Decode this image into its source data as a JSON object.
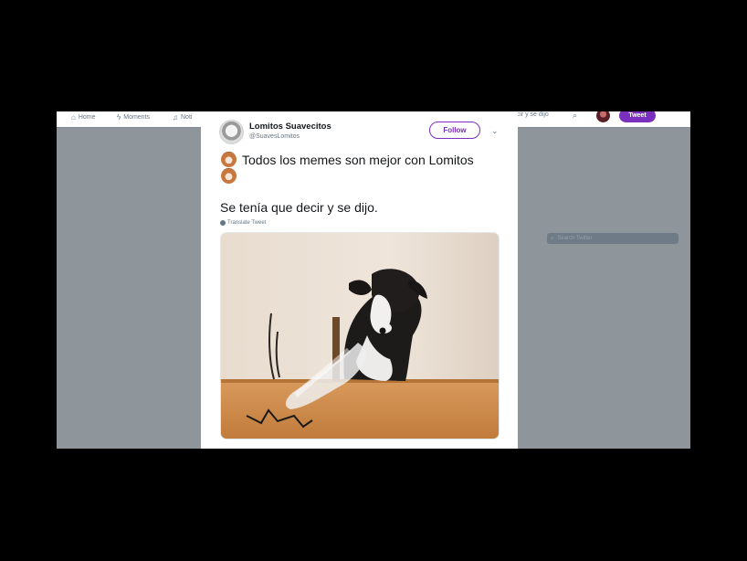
{
  "topbar": {
    "nav": [
      {
        "label": "Home",
        "icon": "home-icon"
      },
      {
        "label": "Moments",
        "icon": "lightning-icon"
      },
      {
        "label": "Noti",
        "icon": "bell-icon"
      }
    ],
    "search_fragment": "decir y se dijo",
    "tweet_button": "Tweet"
  },
  "sidebar": {
    "search_placeholder": "Search Twitter"
  },
  "tweet": {
    "display_name": "Lomitos Suavecitos",
    "handle": "@SuavesLomitos",
    "follow_label": "Follow",
    "text_line1": "Todos los memes son mejor con Lomitos",
    "text_line2": "Se tenía que decir y se dijo.",
    "translate_label": "Translate Tweet",
    "media_description_icon": "dog-photo"
  },
  "colors": {
    "accent": "#7b2fbe",
    "backdrop": "#000000",
    "card": "#ffffff"
  }
}
